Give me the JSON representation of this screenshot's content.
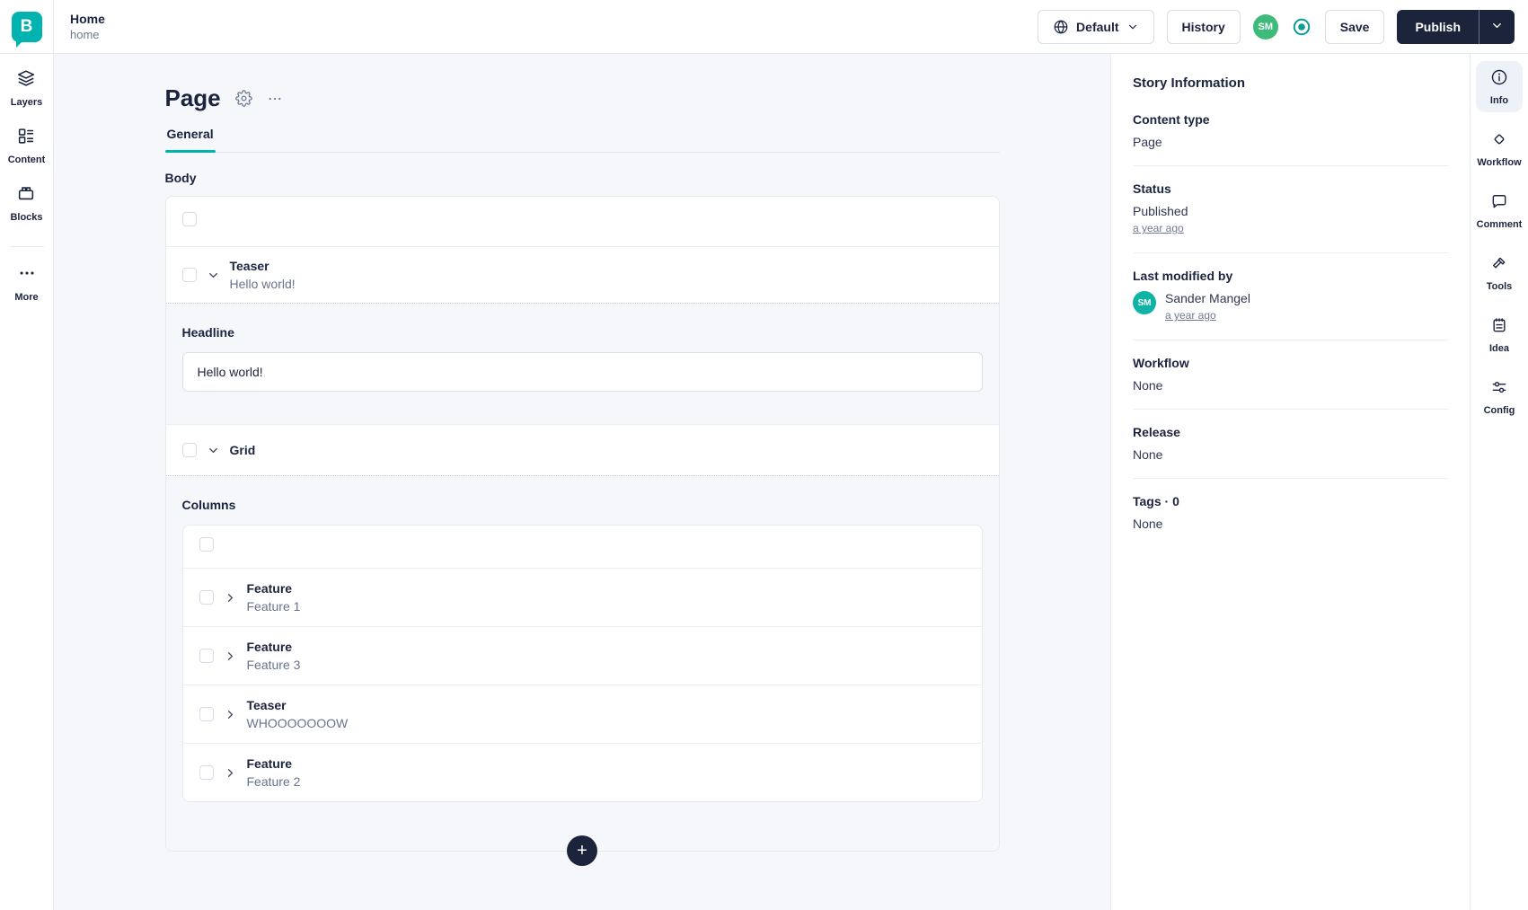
{
  "topbar": {
    "story_title": "Home",
    "story_slug": "home",
    "language": "Default",
    "history": "History",
    "avatar_initials": "SM",
    "save": "Save",
    "publish": "Publish"
  },
  "left_nav": {
    "items": [
      {
        "label": "Layers",
        "icon": "layers-icon"
      },
      {
        "label": "Content",
        "icon": "content-icon"
      },
      {
        "label": "Blocks",
        "icon": "blocks-icon"
      },
      {
        "label": "More",
        "icon": "more-icon"
      }
    ]
  },
  "editor": {
    "title": "Page",
    "tab_general": "General",
    "body_label": "Body",
    "teaser": {
      "title": "Teaser",
      "subtitle": "Hello world!"
    },
    "headline": {
      "label": "Headline",
      "value": "Hello world!"
    },
    "grid_title": "Grid",
    "columns_label": "Columns",
    "columns": [
      {
        "title": "Feature",
        "subtitle": "Feature 1"
      },
      {
        "title": "Feature",
        "subtitle": "Feature 3"
      },
      {
        "title": "Teaser",
        "subtitle": "WHOOOOOOOW"
      },
      {
        "title": "Feature",
        "subtitle": "Feature 2"
      }
    ],
    "add_block": "+"
  },
  "story_info": {
    "panel_title": "Story Information",
    "content_type_label": "Content type",
    "content_type_value": "Page",
    "status_label": "Status",
    "status_value": "Published",
    "status_time": "a year ago",
    "modified_label": "Last modified by",
    "modified_by": "Sander Mangel",
    "modified_initials": "SM",
    "modified_time": "a year ago",
    "workflow_label": "Workflow",
    "workflow_value": "None",
    "release_label": "Release",
    "release_value": "None",
    "tags_label": "Tags · 0",
    "tags_value": "None"
  },
  "right_rail": {
    "items": [
      {
        "label": "Info",
        "icon": "info-icon",
        "active": true
      },
      {
        "label": "Workflow",
        "icon": "workflow-icon"
      },
      {
        "label": "Comment",
        "icon": "comment-icon"
      },
      {
        "label": "Tools",
        "icon": "tools-icon"
      },
      {
        "label": "Idea",
        "icon": "idea-icon"
      },
      {
        "label": "Config",
        "icon": "config-icon"
      }
    ]
  },
  "colors": {
    "brand_teal": "#00b3b0",
    "navy": "#1b243b",
    "avatar_green": "#3eba7a",
    "panel_avatar_teal": "#0fb3a6",
    "background": "#f6f7fb"
  }
}
